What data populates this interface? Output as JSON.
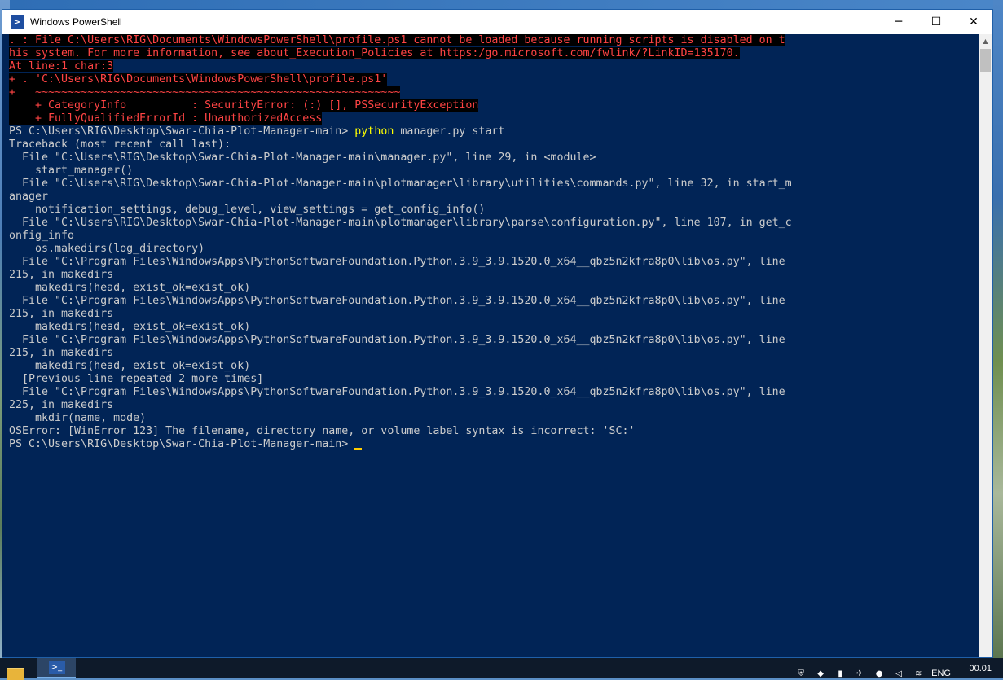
{
  "window": {
    "title": "Windows PowerShell",
    "minimize_glyph": "─",
    "maximize_glyph": "☐",
    "close_glyph": "✕"
  },
  "console": {
    "lines": [
      {
        "text": ". : File C:\\Users\\RIG\\Documents\\WindowsPowerShell\\profile.ps1 cannot be loaded because running scripts is disabled on t",
        "style": "err"
      },
      {
        "text": "his system. For more information, see about_Execution_Policies at https:/go.microsoft.com/fwlink/?LinkID=135170.",
        "style": "err"
      },
      {
        "text": "At line:1 char:3",
        "style": "err"
      },
      {
        "text": "+ . 'C:\\Users\\RIG\\Documents\\WindowsPowerShell\\profile.ps1'",
        "style": "err"
      },
      {
        "text": "+   ~~~~~~~~~~~~~~~~~~~~~~~~~~~~~~~~~~~~~~~~~~~~~~~~~~~~~~~~",
        "style": "err"
      },
      {
        "text": "    + CategoryInfo          : SecurityError: (:) [], PSSecurityException",
        "style": "err"
      },
      {
        "text": "    + FullyQualifiedErrorId : UnauthorizedAccess",
        "style": "err"
      },
      {
        "text": "PS C:\\Users\\RIG\\Desktop\\Swar-Chia-Plot-Manager-main> ",
        "style": "prompt",
        "cmd": "python",
        "args": " manager.py start"
      },
      {
        "text": "Traceback (most recent call last):",
        "style": "out"
      },
      {
        "text": "  File \"C:\\Users\\RIG\\Desktop\\Swar-Chia-Plot-Manager-main\\manager.py\", line 29, in <module>",
        "style": "out"
      },
      {
        "text": "    start_manager()",
        "style": "out"
      },
      {
        "text": "  File \"C:\\Users\\RIG\\Desktop\\Swar-Chia-Plot-Manager-main\\plotmanager\\library\\utilities\\commands.py\", line 32, in start_m",
        "style": "out"
      },
      {
        "text": "anager",
        "style": "out"
      },
      {
        "text": "    notification_settings, debug_level, view_settings = get_config_info()",
        "style": "out"
      },
      {
        "text": "  File \"C:\\Users\\RIG\\Desktop\\Swar-Chia-Plot-Manager-main\\plotmanager\\library\\parse\\configuration.py\", line 107, in get_c",
        "style": "out"
      },
      {
        "text": "onfig_info",
        "style": "out"
      },
      {
        "text": "    os.makedirs(log_directory)",
        "style": "out"
      },
      {
        "text": "  File \"C:\\Program Files\\WindowsApps\\PythonSoftwareFoundation.Python.3.9_3.9.1520.0_x64__qbz5n2kfra8p0\\lib\\os.py\", line",
        "style": "out"
      },
      {
        "text": "215, in makedirs",
        "style": "out"
      },
      {
        "text": "    makedirs(head, exist_ok=exist_ok)",
        "style": "out"
      },
      {
        "text": "  File \"C:\\Program Files\\WindowsApps\\PythonSoftwareFoundation.Python.3.9_3.9.1520.0_x64__qbz5n2kfra8p0\\lib\\os.py\", line",
        "style": "out"
      },
      {
        "text": "215, in makedirs",
        "style": "out"
      },
      {
        "text": "    makedirs(head, exist_ok=exist_ok)",
        "style": "out"
      },
      {
        "text": "  File \"C:\\Program Files\\WindowsApps\\PythonSoftwareFoundation.Python.3.9_3.9.1520.0_x64__qbz5n2kfra8p0\\lib\\os.py\", line",
        "style": "out"
      },
      {
        "text": "215, in makedirs",
        "style": "out"
      },
      {
        "text": "    makedirs(head, exist_ok=exist_ok)",
        "style": "out"
      },
      {
        "text": "  [Previous line repeated 2 more times]",
        "style": "out"
      },
      {
        "text": "  File \"C:\\Program Files\\WindowsApps\\PythonSoftwareFoundation.Python.3.9_3.9.1520.0_x64__qbz5n2kfra8p0\\lib\\os.py\", line",
        "style": "out"
      },
      {
        "text": "225, in makedirs",
        "style": "out"
      },
      {
        "text": "    mkdir(name, mode)",
        "style": "out"
      },
      {
        "text": "OSError: [WinError 123] The filename, directory name, or volume label syntax is incorrect: 'SC:'",
        "style": "out"
      },
      {
        "text": "PS C:\\Users\\RIG\\Desktop\\Swar-Chia-Plot-Manager-main> ",
        "style": "current"
      }
    ]
  },
  "colors": {
    "console_bg": "#012456",
    "error_fg": "#ff4444",
    "command_fg": "#ffff00",
    "text_fg": "#cccccc"
  },
  "taskbar": {
    "folder_icon": "file-explorer-icon",
    "ps_icon": "powershell-icon",
    "language": "ENG",
    "clock": "00.01"
  }
}
